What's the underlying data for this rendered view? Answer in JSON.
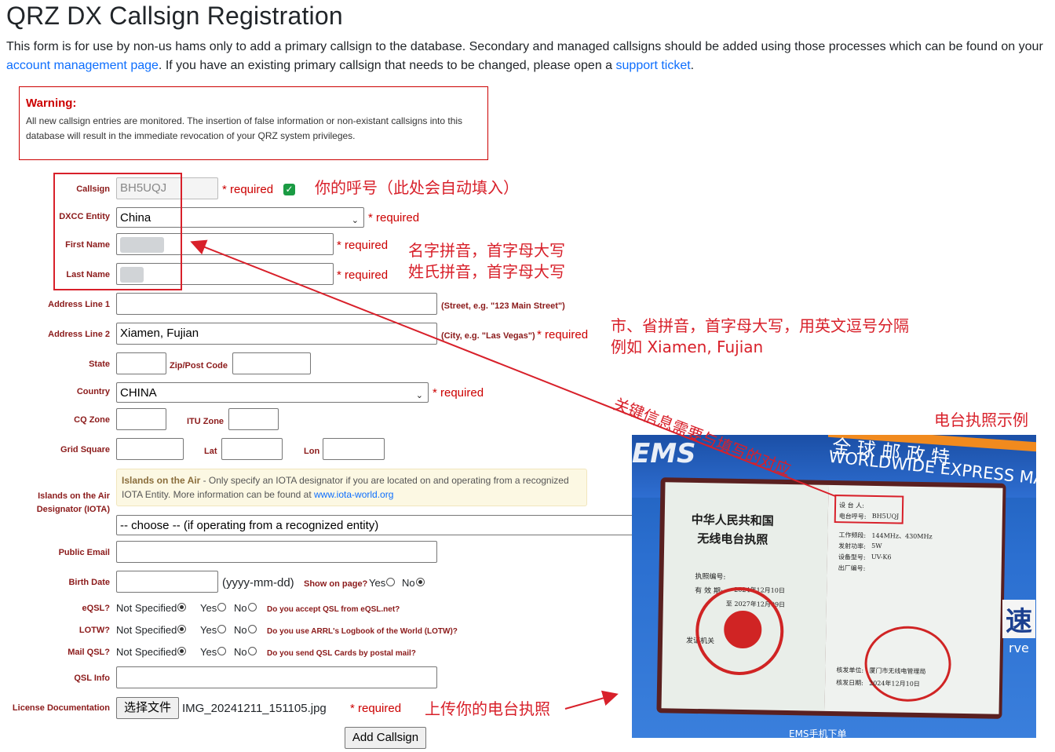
{
  "page": {
    "title": "QRZ DX Callsign Registration",
    "intro_part1": "This form is for use by non-us hams only to add a primary callsign to the database.  Secondary and managed callsigns should be added using those processes which can be found on your ",
    "intro_link1": "account management page",
    "intro_part2": ".  If you have an existing primary callsign that needs to be changed, please open a ",
    "intro_link2": "support ticket",
    "intro_part3": "."
  },
  "warning": {
    "title": "Warning:",
    "text": "All new callsign entries are monitored. The insertion of false information or non-existant callsigns into this database will result in the immediate revocation of your QRZ system privileges."
  },
  "form": {
    "callsign": {
      "label": "Callsign",
      "value": "BH5UQJ",
      "required": "* required"
    },
    "dxcc": {
      "label": "DXCC Entity",
      "value": "China",
      "required": "* required"
    },
    "first_name": {
      "label": "First Name",
      "required": "* required"
    },
    "last_name": {
      "label": "Last Name",
      "required": "* required"
    },
    "address1": {
      "label": "Address Line 1",
      "hint": "(Street, e.g. \"123 Main Street\")"
    },
    "address2": {
      "label": "Address Line 2",
      "value": "Xiamen, Fujian",
      "hint": "(City, e.g. \"Las Vegas\")",
      "required": "* required"
    },
    "state": {
      "label": "State"
    },
    "zip": {
      "label": "Zip/Post Code"
    },
    "country": {
      "label": "Country",
      "value": "CHINA",
      "required": "* required"
    },
    "cq_zone": {
      "label": "CQ Zone"
    },
    "itu_zone": {
      "label": "ITU Zone"
    },
    "grid": {
      "label": "Grid Square"
    },
    "lat": {
      "label": "Lat"
    },
    "lon": {
      "label": "Lon"
    },
    "iota": {
      "label": "Islands on the Air Designator (IOTA)",
      "box_title": "Islands on the Air",
      "box_text": " - Only specify an IOTA designator if you are located on and operating from a recognized IOTA Entity. More information can be found at ",
      "box_link": "www.iota-world.org",
      "select_value": "-- choose -- (if operating from a recognized entity)"
    },
    "public_email": {
      "label": "Public Email"
    },
    "birth_date": {
      "label": "Birth Date",
      "format": "(yyyy-mm-dd)",
      "show_label": "Show on page?",
      "yes": "Yes",
      "no": "No"
    },
    "eqsl": {
      "label": "eQSL?",
      "not_specified": "Not Specified",
      "yes": "Yes",
      "no": "No",
      "question": "Do you accept QSL from eQSL.net?"
    },
    "lotw": {
      "label": "LOTW?",
      "not_specified": "Not Specified",
      "yes": "Yes",
      "no": "No",
      "question": "Do you use ARRL's Logbook of the World (LOTW)?"
    },
    "mail_qsl": {
      "label": "Mail QSL?",
      "not_specified": "Not Specified",
      "yes": "Yes",
      "no": "No",
      "question": "Do you send QSL Cards by postal mail?"
    },
    "qsl_info": {
      "label": "QSL Info"
    },
    "license": {
      "label": "License Documentation",
      "button": "选择文件",
      "filename": "IMG_20241211_151105.jpg",
      "required": "* required"
    },
    "submit": "Add Callsign"
  },
  "annotations": {
    "callsign_note": "你的呼号（此处会自动填入）",
    "name_note_1": "名字拼音，首字母大写",
    "name_note_2": "姓氏拼音，首字母大写",
    "city_note_1": "市、省拼音，首字母大写，用英文逗号分隔",
    "city_note_2": "例如 Xiamen, Fujian",
    "arrow_note": "关键信息需要与填写的对应",
    "photo_title": "电台执照示例",
    "upload_note": "上传你的电台执照"
  },
  "photo": {
    "bg_text_1": "全 球 邮 政 特",
    "bg_text_2": "WORLDWIDE EXPRESS MA",
    "book_title_1": "中华人民共和国",
    "book_title_2": "无线电台执照",
    "field_holder": "设 台 人:",
    "field_callsign": "电台呼号:",
    "callsign_value": "BH5UQJ",
    "field_band": "工作频段:",
    "band_value": "144MHz、430MHz",
    "field_power": "发射功率:",
    "power_value": "5W",
    "field_model": "设备型号:",
    "model_value": "UV-K6",
    "field_serial": "出厂编号:",
    "license_no": "执照编号:",
    "valid": "有 效 期:",
    "valid_from": "2024年12月10日",
    "valid_to": "至 2027年12月09日",
    "issuer": "发证机关",
    "approver": "核发单位:",
    "approver_value": "厦门市无线电管理局",
    "approve_date_label": "核发日期:",
    "approve_date": "2024年12月10日",
    "ems": "EMS手机下单",
    "speed": "速",
    "erve": "rve"
  }
}
